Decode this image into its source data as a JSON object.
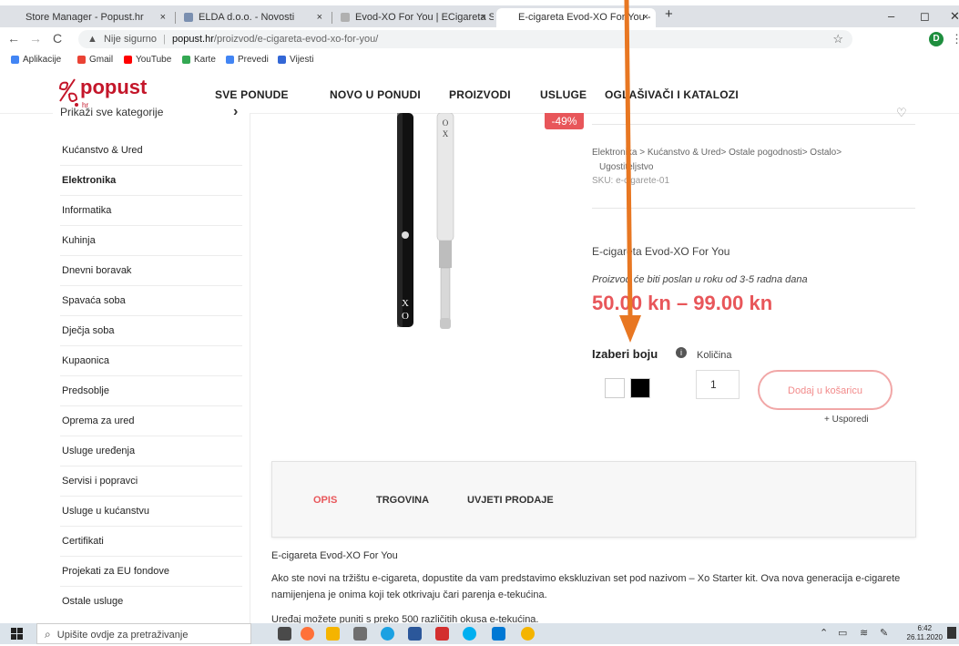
{
  "browser": {
    "tabs": [
      {
        "title": "Store Manager - Popust.hr",
        "fav_color": "#cfcfcf"
      },
      {
        "title": "ELDA d.o.o. - Novosti",
        "fav_color": "#7a8fb0"
      },
      {
        "title": "Evod-XO For You | ECigareta Sho",
        "fav_color": "#b0b0b0"
      },
      {
        "title": "E-cigareta Evod-XO For You -",
        "fav_color": "#ffffff"
      }
    ],
    "new_tab": "+",
    "tab_close": "×",
    "window_min": "–",
    "window_max": "◻",
    "window_close": "✕",
    "back": "←",
    "forward": "→",
    "reload": "C",
    "insecure_label": "Nije sigurno",
    "url_domain": "popust.hr",
    "url_path": "/proizvod/e-cigareta-evod-xo-for-you/",
    "star": "☆",
    "profile_initial": "D",
    "menu": "⋮",
    "bookmarks": [
      {
        "label": "Aplikacije",
        "color": "#4285f4"
      },
      {
        "label": "Gmail",
        "color": "#ea4335"
      },
      {
        "label": "YouTube",
        "color": "#ff0000"
      },
      {
        "label": "Karte",
        "color": "#34a853"
      },
      {
        "label": "Prevedi",
        "color": "#4285f4"
      },
      {
        "label": "Vijesti",
        "color": "#3367d6"
      }
    ]
  },
  "site": {
    "logo_text": "popust",
    "logo_sub": "hr",
    "brand_color": "#c4162a",
    "menu": [
      "SVE PONUDE",
      "NOVO U PONUDI",
      "PROIZVODI",
      "USLUGE",
      "OGLAŠIVAČI I KATALOZI"
    ]
  },
  "sidebar": {
    "header": "Prikaži sve kategorije",
    "header_arrow": "›",
    "items": [
      {
        "label": "Kućanstvo & Ured",
        "bold": false
      },
      {
        "label": "Elektronika",
        "bold": true
      },
      {
        "label": "Informatika",
        "bold": false
      },
      {
        "label": "Kuhinja",
        "bold": false
      },
      {
        "label": "Dnevni boravak",
        "bold": false
      },
      {
        "label": "Spavaća soba",
        "bold": false
      },
      {
        "label": "Dječja soba",
        "bold": false
      },
      {
        "label": "Kupaonica",
        "bold": false
      },
      {
        "label": "Predsoblje",
        "bold": false
      },
      {
        "label": "Oprema za ured",
        "bold": false
      },
      {
        "label": "Usluge uređenja",
        "bold": false
      },
      {
        "label": "Servisi i popravci",
        "bold": false
      },
      {
        "label": "Usluge u kućanstvu",
        "bold": false
      },
      {
        "label": "Certifikati",
        "bold": false
      },
      {
        "label": "Projekati za EU fondove",
        "bold": false
      },
      {
        "label": "Ostale usluge",
        "bold": false
      }
    ]
  },
  "product": {
    "discount_badge": "-49%",
    "breadcrumb_line1": "Elektronika > Kućanstvo & Ured> Ostale pogodnosti> Ostalo>",
    "breadcrumb_line2": "Ugostiteljstvo",
    "sku": "SKU: e-cigarete-01",
    "name": "E-cigareta Evod-XO For You",
    "shipping_note": "Proizvod će biti poslan u roku od 3-5 radna dana",
    "price": "50.00 kn – 99.00 kn",
    "color_label": "Izaberi boju",
    "info_icon": "i",
    "qty_label": "Količina",
    "qty_value": "1",
    "add_to_cart": "Dodaj u košaricu",
    "compare": "+ Usporedi",
    "swatches": [
      "#ffffff",
      "#000000"
    ]
  },
  "product_tabs": [
    "OPIS",
    "TRGOVINA",
    "UVJETI PRODAJE"
  ],
  "description": {
    "title": "E-cigareta Evod-XO For You",
    "body": "Ako ste novi na tržištu e-cigareta, dopustite da vam predstavimo ekskluzivan set pod nazivom – Xo Starter kit. Ova nova generacija e-cigarete namijenjena je onima koji tek otkrivaju čari parenja e-tekućina.",
    "more": "Uređaj možete puniti s preko 500 različitih okusa e-tekućina."
  },
  "taskbar": {
    "search_placeholder": "Upišite ovdje za pretraživanje",
    "time": "6:42",
    "date": "26.11.2020",
    "apps": [
      "#4a4a4a",
      "#ff7139",
      "#f5b400",
      "#6f6f6f",
      "#1ba1e2",
      "#2b579a",
      "#d32f2f",
      "#00aff0",
      "#0078d4",
      "#f4b400"
    ]
  },
  "annotation": {
    "arrow_color": "#e87722"
  }
}
